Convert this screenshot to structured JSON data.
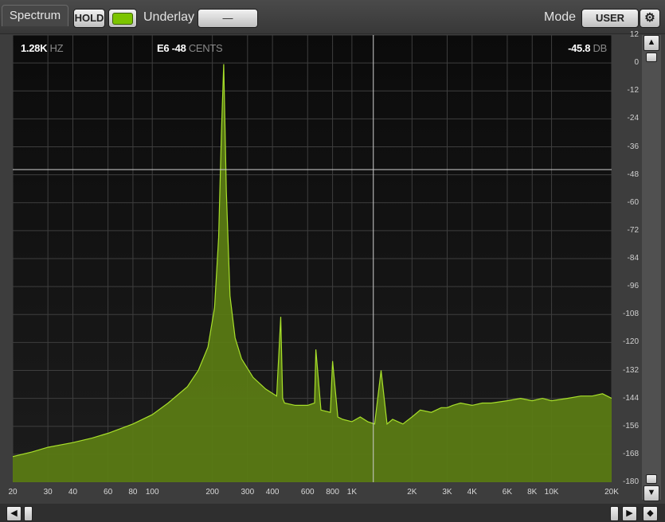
{
  "toolbar": {
    "tab_label": "Spectrum",
    "hold_label": "HOLD",
    "underlay_label": "Underlay",
    "underlay_value": "—",
    "mode_label": "Mode",
    "mode_value": "USER",
    "colors": {
      "toggle_green": "#7cc400",
      "plot_fill": "#5b7d14",
      "plot_line": "#a8e02a"
    }
  },
  "readout": {
    "freq_value": "1.28K",
    "freq_unit": "HZ",
    "note_value": "E6 -48",
    "note_unit": "CENTS",
    "level_value": "-45.8",
    "level_unit": "DB"
  },
  "chart_data": {
    "type": "area",
    "xscale": "log",
    "xlim": [
      20,
      20000
    ],
    "ylim": [
      -180,
      12
    ],
    "grid": true,
    "x_ticks": [
      "20",
      "30",
      "40",
      "60",
      "80",
      "100",
      "200",
      "300",
      "400",
      "600",
      "800",
      "1K",
      "2K",
      "3K",
      "4K",
      "6K",
      "8K",
      "10K",
      "20K"
    ],
    "y_ticks": [
      "12",
      "0",
      "-12",
      "-24",
      "-36",
      "-48",
      "-60",
      "-72",
      "-84",
      "-96",
      "-108",
      "-120",
      "-132",
      "-144",
      "-156",
      "-168",
      "-180"
    ],
    "cursor": {
      "freq_hz": 1280,
      "level_db": -45.8
    },
    "series": [
      {
        "x": [
          20,
          25,
          30,
          40,
          50,
          60,
          80,
          100,
          120,
          150,
          170,
          190,
          205,
          215,
          222,
          228,
          235,
          245,
          260,
          280,
          320,
          370,
          420,
          440,
          450,
          460,
          520,
          600,
          650,
          660,
          700,
          780,
          800,
          850,
          900,
          1000,
          1100,
          1200,
          1300,
          1400,
          1500,
          1600,
          1800,
          2000,
          2200,
          2500,
          2800,
          3000,
          3200,
          3500,
          4000,
          4500,
          5000,
          6000,
          7000,
          8000,
          9000,
          10000,
          12000,
          14000,
          16000,
          18000,
          20000
        ],
        "y": [
          -169,
          -167,
          -165,
          -163,
          -161,
          -159,
          -155,
          -151,
          -146,
          -139,
          -132,
          -122,
          -105,
          -75,
          -30,
          -0.5,
          -55,
          -100,
          -118,
          -127,
          -135,
          -140,
          -143,
          -109,
          -144,
          -146,
          -147,
          -147,
          -146,
          -123,
          -149,
          -150,
          -128,
          -152,
          -153,
          -154,
          -152,
          -154,
          -155,
          -132,
          -155,
          -153,
          -155,
          -152,
          -149,
          -150,
          -148,
          -148,
          -147,
          -146,
          -147,
          -146,
          -146,
          -145,
          -144,
          -145,
          -144,
          -145,
          -144,
          -143,
          -143,
          -142,
          -144
        ]
      }
    ]
  }
}
